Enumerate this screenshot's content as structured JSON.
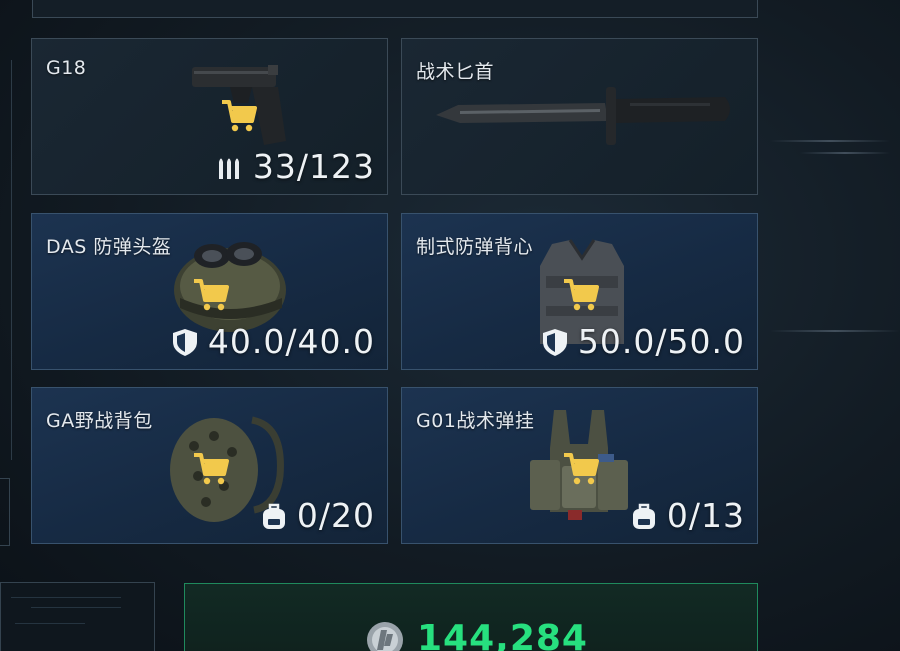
{
  "cards": [
    {
      "name": "G18",
      "stat": "33/123",
      "stat_icon": "ammo-icon",
      "selected": false
    },
    {
      "name": "战术匕首",
      "stat": "",
      "stat_icon": "",
      "selected": false
    },
    {
      "name": "DAS 防弹头盔",
      "stat": "40.0/40.0",
      "stat_icon": "shield-icon",
      "selected": true
    },
    {
      "name": "制式防弹背心",
      "stat": "50.0/50.0",
      "stat_icon": "shield-icon",
      "selected": true
    },
    {
      "name": "GA野战背包",
      "stat": "0/20",
      "stat_icon": "backpack-icon",
      "selected": true
    },
    {
      "name": "G01战术弹挂",
      "stat": "0/13",
      "stat_icon": "backpack-icon",
      "selected": true
    }
  ],
  "currency": {
    "amount": "144,284",
    "icon": "coin-icon",
    "color": "#27e07f"
  },
  "colors": {
    "cart": "#f2c94c",
    "card_blue": "#1c3350",
    "card_dark": "#1a2733",
    "currency_border": "#1f8a5d"
  }
}
